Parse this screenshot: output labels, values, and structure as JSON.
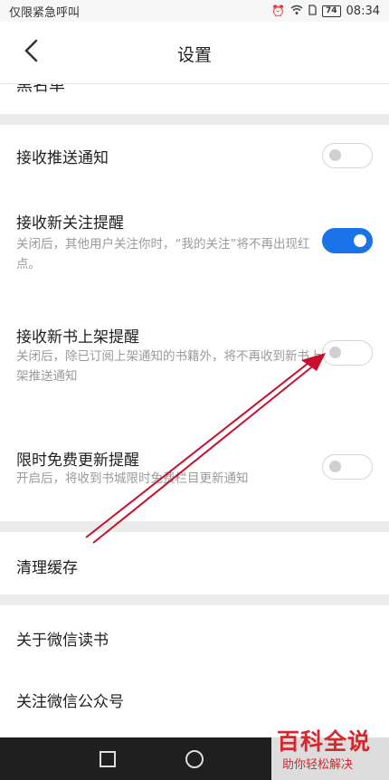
{
  "status_bar": {
    "left_text": "仅限紧急呼叫",
    "battery": "74",
    "time": "08:34"
  },
  "nav": {
    "title": "设置"
  },
  "clipped_row": {
    "label": "黑名单"
  },
  "settings": [
    {
      "title": "接收推送通知",
      "desc": "",
      "enabled": false
    },
    {
      "title": "接收新关注提醒",
      "desc": "关闭后，其他用户关注你时，“我的关注”将不再出现红点。",
      "enabled": true
    },
    {
      "title": "接收新书上架提醒",
      "desc": "关闭后，除已订阅上架通知的书籍外，将不再收到新书上架推送通知",
      "enabled": false
    },
    {
      "title": "限时免费更新提醒",
      "desc": "开启后，将收到书城限时免费栏目更新通知",
      "enabled": false
    }
  ],
  "clear_cache": {
    "label": "清理缓存"
  },
  "about": {
    "label": "关于微信读书"
  },
  "follow": {
    "label": "关注微信公众号"
  },
  "watermark": {
    "main": "百科全说",
    "sub": "助你轻松解决"
  },
  "colors": {
    "toggle_on": "#1a73e8",
    "arrow": "#c8102e",
    "watermark": "#d6272d"
  }
}
